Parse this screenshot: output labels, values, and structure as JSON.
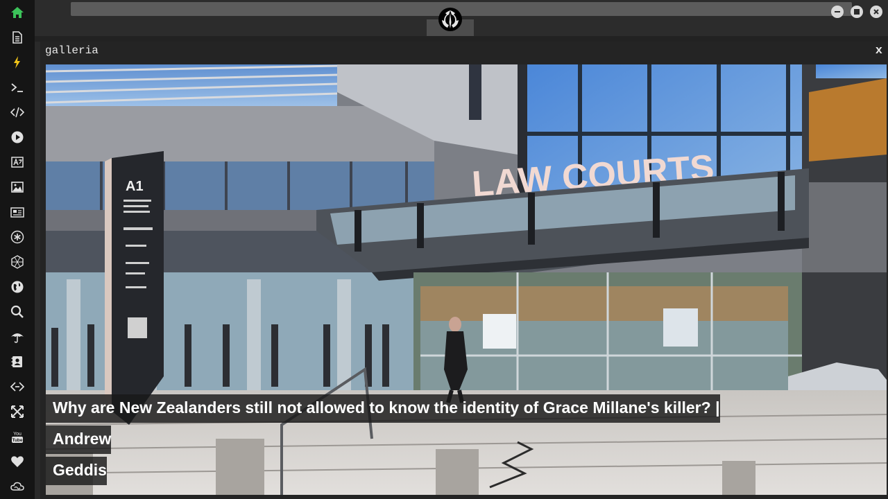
{
  "sidebar": {
    "items": [
      {
        "name": "home",
        "icon": "home-icon",
        "color": "#3cc35a"
      },
      {
        "name": "document",
        "icon": "document-icon",
        "color": "#e0e0e0"
      },
      {
        "name": "lightning",
        "icon": "lightning-icon",
        "color": "#f0c419"
      },
      {
        "name": "terminal",
        "icon": "terminal-icon",
        "color": "#e0e0e0"
      },
      {
        "name": "code",
        "icon": "code-icon",
        "color": "#e0e0e0"
      },
      {
        "name": "play",
        "icon": "play-icon",
        "color": "#e0e0e0"
      },
      {
        "name": "translate",
        "icon": "translate-icon",
        "color": "#e0e0e0"
      },
      {
        "name": "image",
        "icon": "image-icon",
        "color": "#e0e0e0"
      },
      {
        "name": "news",
        "icon": "newspaper-icon",
        "color": "#e0e0e0"
      },
      {
        "name": "settings",
        "icon": "asterisk-icon",
        "color": "#e0e0e0"
      },
      {
        "name": "hexagon",
        "icon": "hexagon-icon",
        "color": "#e0e0e0"
      },
      {
        "name": "globe",
        "icon": "globe-icon",
        "color": "#e0e0e0"
      },
      {
        "name": "search",
        "icon": "search-icon",
        "color": "#e0e0e0"
      },
      {
        "name": "umbrella",
        "icon": "umbrella-icon",
        "color": "#e0e0e0"
      },
      {
        "name": "contact",
        "icon": "contact-card-icon",
        "color": "#e0e0e0"
      },
      {
        "name": "code-link",
        "icon": "code-link-icon",
        "color": "#e0e0e0"
      },
      {
        "name": "expand",
        "icon": "expand-icon",
        "color": "#e0e0e0"
      },
      {
        "name": "youtube",
        "icon": "youtube-icon",
        "color": "#e0e0e0"
      },
      {
        "name": "favorites",
        "icon": "heart-icon",
        "color": "#e0e0e0"
      },
      {
        "name": "cloud",
        "icon": "cloud-icon",
        "color": "#e0e0e0"
      }
    ]
  },
  "window": {
    "logo_icon": "rebel-alliance-logo-icon",
    "controls": [
      "minimize-icon",
      "maximize-icon",
      "close-icon"
    ]
  },
  "panel": {
    "title": "galleria",
    "close_label": "x"
  },
  "gallery": {
    "image_description": "photo",
    "sign_text": "LAW COURTS",
    "pillar_text": "A1",
    "caption_line1": "Why are New Zealanders still not allowed to know the identity of Grace Millane's killer? | Andrew",
    "caption_line2": "Geddis"
  },
  "colors": {
    "sidebar_bg": "#151515",
    "accent_green": "#3cc35a",
    "accent_yellow": "#f0c419"
  }
}
